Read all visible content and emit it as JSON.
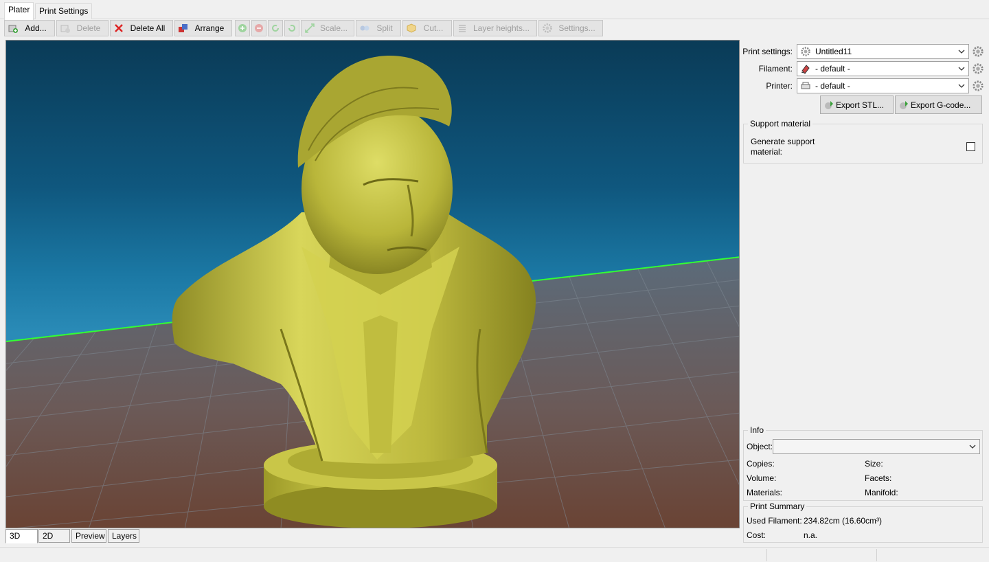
{
  "tabs": [
    "Plater",
    "Print Settings"
  ],
  "toolbar": {
    "add": "Add...",
    "delete": "Delete",
    "delete_all": "Delete All",
    "arrange": "Arrange",
    "scale": "Scale...",
    "split": "Split",
    "cut": "Cut...",
    "layer_heights": "Layer heights...",
    "settings": "Settings..."
  },
  "view_tabs": [
    "3D",
    "2D",
    "Preview",
    "Layers"
  ],
  "presets": {
    "print_label": "Print settings:",
    "print_value": "Untitled11",
    "filament_label": "Filament:",
    "filament_value": "- default -",
    "printer_label": "Printer:",
    "printer_value": "- default -"
  },
  "export": {
    "stl": "Export STL...",
    "gcode": "Export G-code..."
  },
  "support": {
    "group_title": "Support material",
    "generate_label_line1": "Generate support",
    "generate_label_line2": "material:",
    "generate_checked": false
  },
  "info": {
    "group_title": "Info",
    "object_label": "Object:",
    "object_value": "",
    "copies": "Copies:",
    "size": "Size:",
    "volume": "Volume:",
    "facets": "Facets:",
    "materials": "Materials:",
    "manifold": "Manifold:"
  },
  "summary": {
    "group_title": "Print Summary",
    "used_filament_label": "Used Filament:",
    "used_filament_value": "234.82cm (16.60cm³)",
    "cost_label": "Cost:",
    "cost_value": "n.a."
  },
  "colors": {
    "sky_top": "#0a3b57",
    "sky_bottom": "#2a8bb7",
    "bed_edge": "#33ff33",
    "model": "#b5b23a"
  }
}
